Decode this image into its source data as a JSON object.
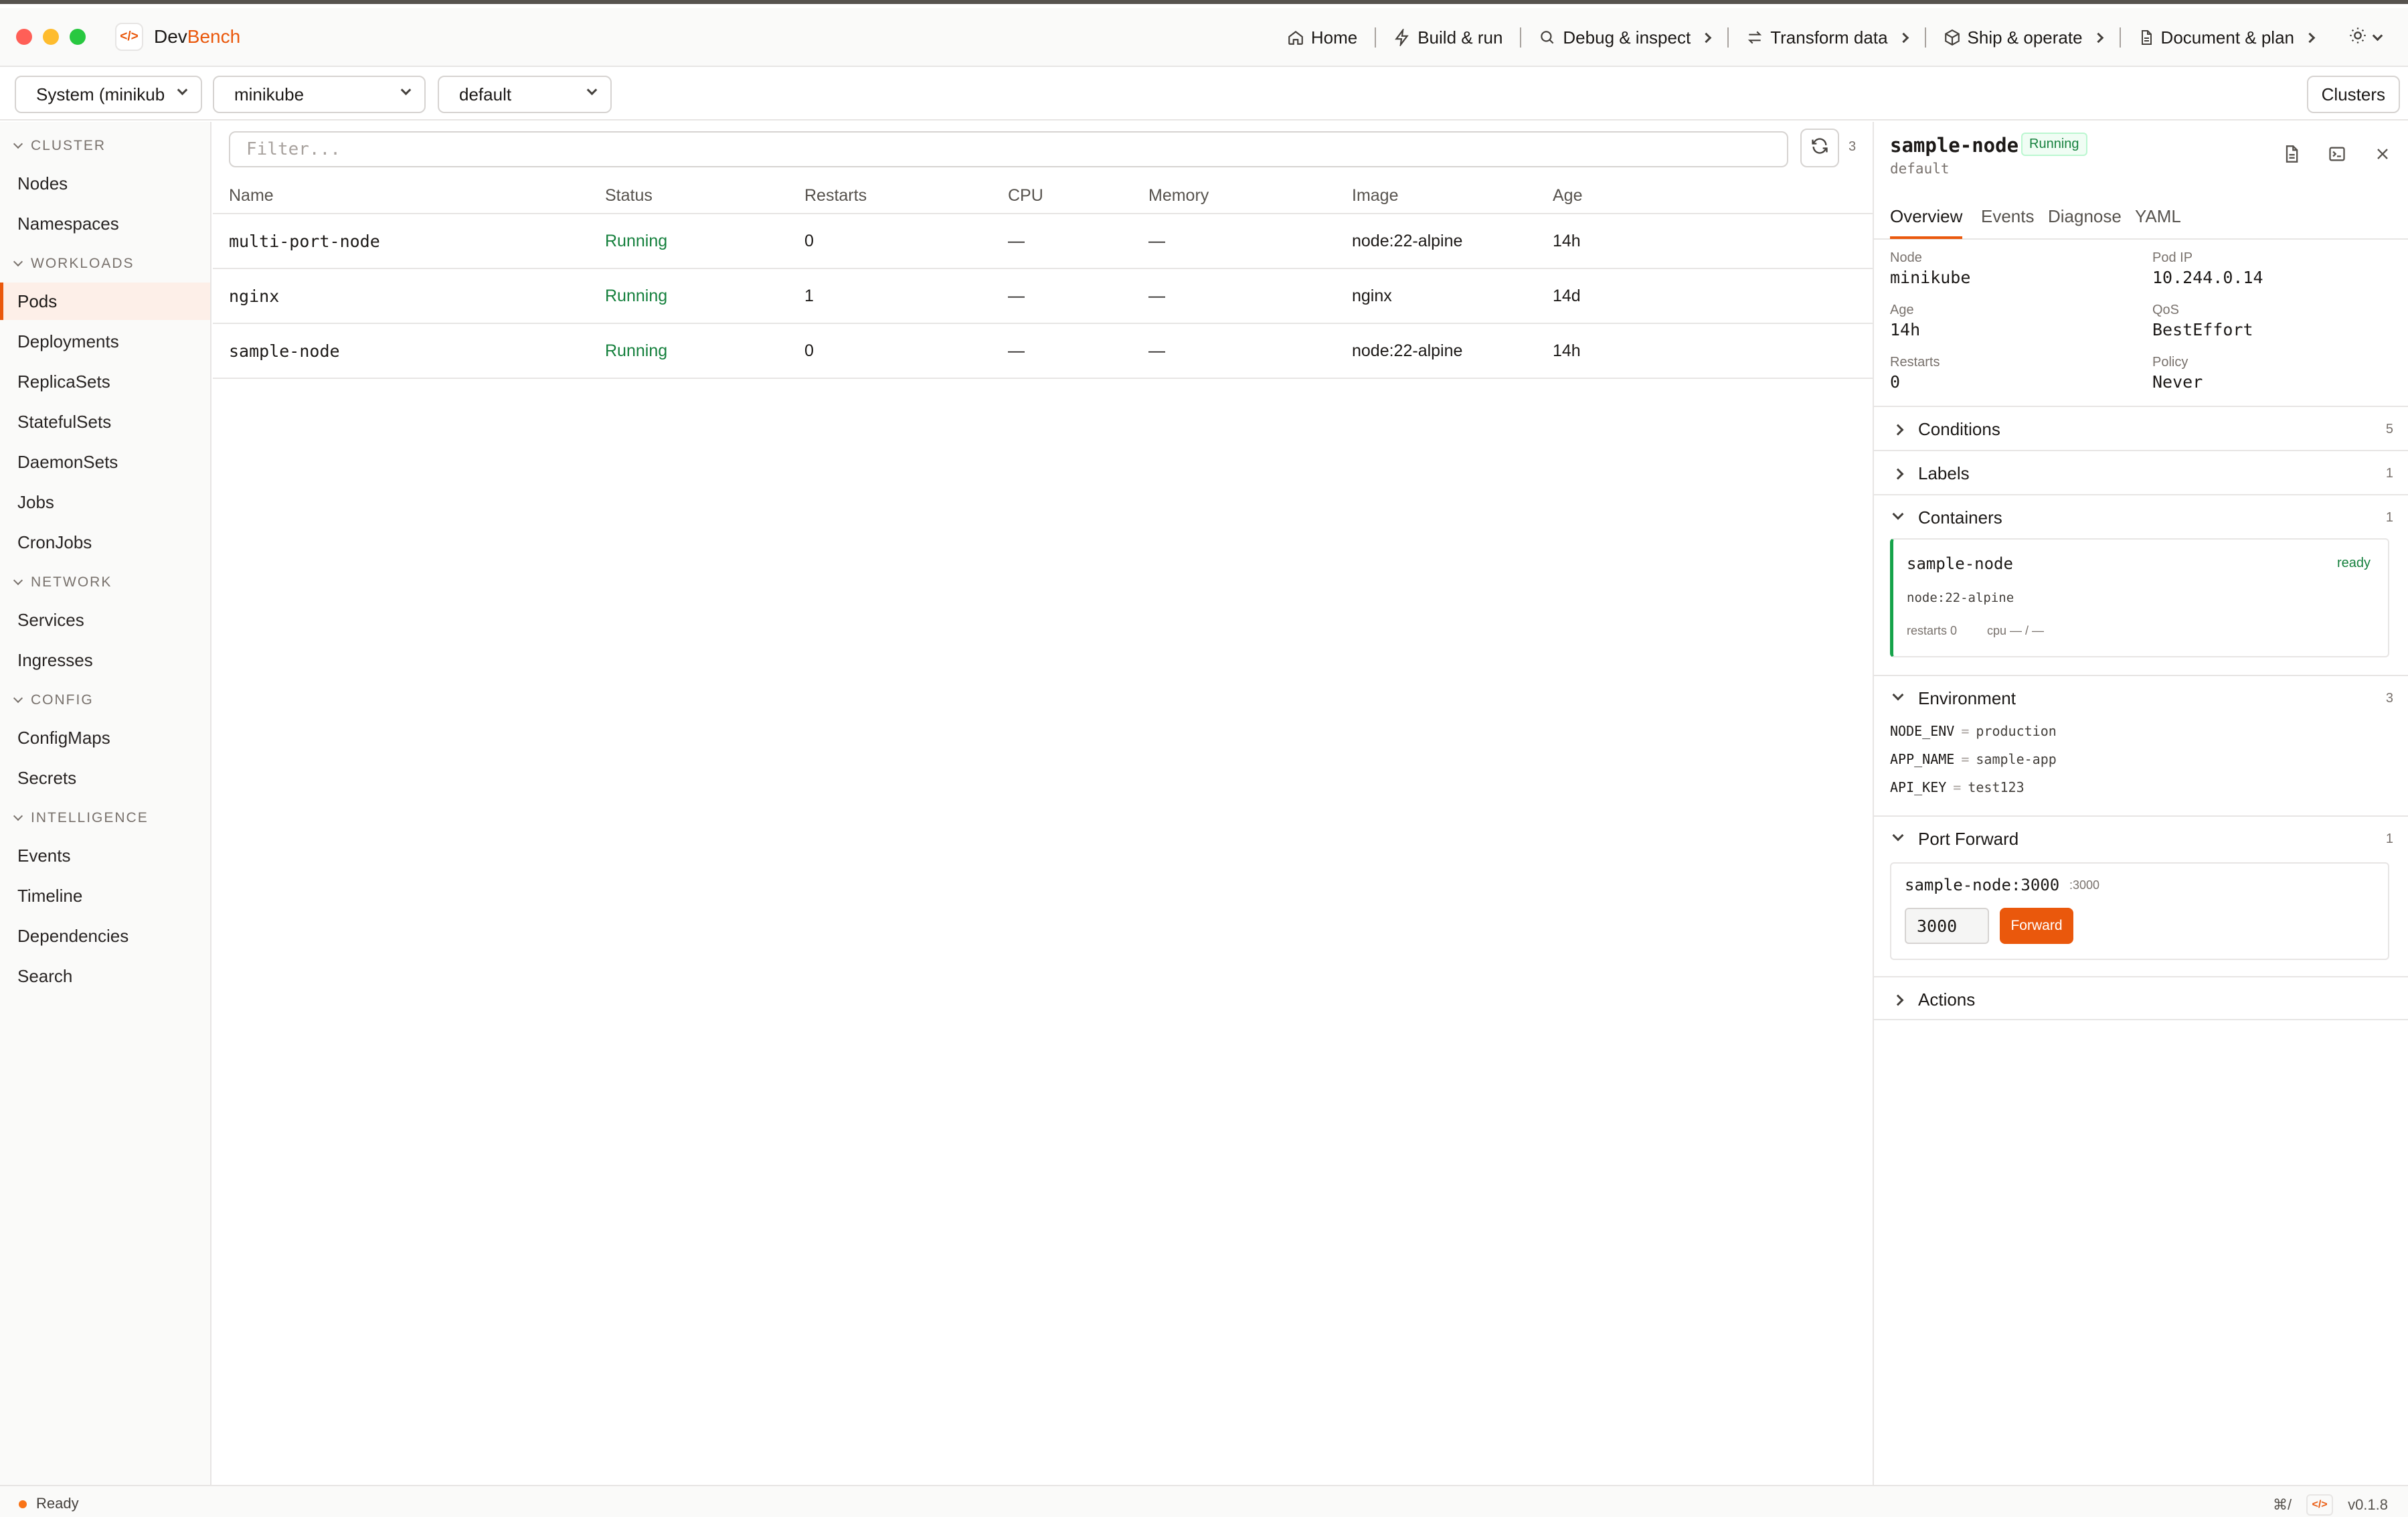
{
  "app": {
    "logo_glyph": "</>",
    "brand_part1": "Dev",
    "brand_part2": "Bench",
    "accent": "#ea580c"
  },
  "topnav": [
    {
      "label": "Home",
      "icon": "home-icon"
    },
    {
      "label": "Build & run",
      "icon": "bolt-icon"
    },
    {
      "label": "Debug & inspect",
      "icon": "search-icon"
    },
    {
      "label": "Transform data",
      "icon": "arrows-icon"
    },
    {
      "label": "Ship & operate",
      "icon": "box-icon"
    },
    {
      "label": "Document & plan",
      "icon": "document-icon"
    }
  ],
  "toolbar": {
    "context": "System (minikub",
    "cluster": "minikube",
    "namespace": "default",
    "clusters_button": "Clusters"
  },
  "sidebar": {
    "sections": [
      {
        "title": "CLUSTER",
        "items": [
          "Nodes",
          "Namespaces"
        ]
      },
      {
        "title": "WORKLOADS",
        "items": [
          "Pods",
          "Deployments",
          "ReplicaSets",
          "StatefulSets",
          "DaemonSets",
          "Jobs",
          "CronJobs"
        ]
      },
      {
        "title": "NETWORK",
        "items": [
          "Services",
          "Ingresses"
        ]
      },
      {
        "title": "CONFIG",
        "items": [
          "ConfigMaps",
          "Secrets"
        ]
      },
      {
        "title": "INTELLIGENCE",
        "items": [
          "Events",
          "Timeline",
          "Dependencies",
          "Search"
        ]
      }
    ],
    "active": "Pods"
  },
  "list": {
    "filter_placeholder": "Filter...",
    "count": "3",
    "columns": [
      "Name",
      "Status",
      "Restarts",
      "CPU",
      "Memory",
      "Image",
      "Age"
    ],
    "rows": [
      {
        "name": "multi-port-node",
        "status": "Running",
        "restarts": "0",
        "cpu": "—",
        "memory": "—",
        "image": "node:22-alpine",
        "age": "14h"
      },
      {
        "name": "nginx",
        "status": "Running",
        "restarts": "1",
        "cpu": "—",
        "memory": "—",
        "image": "nginx",
        "age": "14d"
      },
      {
        "name": "sample-node",
        "status": "Running",
        "restarts": "0",
        "cpu": "—",
        "memory": "—",
        "image": "node:22-alpine",
        "age": "14h"
      }
    ]
  },
  "detail": {
    "title": "sample-node",
    "status": "Running",
    "namespace": "default",
    "tabs": [
      "Overview",
      "Events",
      "Diagnose",
      "YAML"
    ],
    "active_tab": "Overview",
    "fields": {
      "node_label": "Node",
      "node": "minikube",
      "podip_label": "Pod IP",
      "podip": "10.244.0.14",
      "age_label": "Age",
      "age": "14h",
      "qos_label": "QoS",
      "qos": "BestEffort",
      "restarts_label": "Restarts",
      "restarts": "0",
      "policy_label": "Policy",
      "policy": "Never"
    },
    "sections": {
      "conditions": {
        "title": "Conditions",
        "count": "5"
      },
      "labels": {
        "title": "Labels",
        "count": "1"
      },
      "containers": {
        "title": "Containers",
        "count": "1"
      },
      "environment": {
        "title": "Environment",
        "count": "3"
      },
      "port_forward": {
        "title": "Port Forward",
        "count": "1"
      },
      "actions": {
        "title": "Actions"
      }
    },
    "container": {
      "name": "sample-node",
      "state": "ready",
      "image": "node:22-alpine",
      "restarts": "restarts 0",
      "cpu": "cpu — / —"
    },
    "env": [
      {
        "key": "NODE_ENV",
        "value": "production"
      },
      {
        "key": "APP_NAME",
        "value": "sample-app"
      },
      {
        "key": "API_KEY",
        "value": "test123"
      }
    ],
    "env_eq": "=",
    "port_forward": {
      "target": "sample-node:3000",
      "port_hint": ":3000",
      "local_port": "3000",
      "button": "Forward"
    }
  },
  "statusbar": {
    "status": "Ready",
    "shortcut": "⌘/",
    "logo_glyph": "</>",
    "version": "v0.1.8"
  }
}
